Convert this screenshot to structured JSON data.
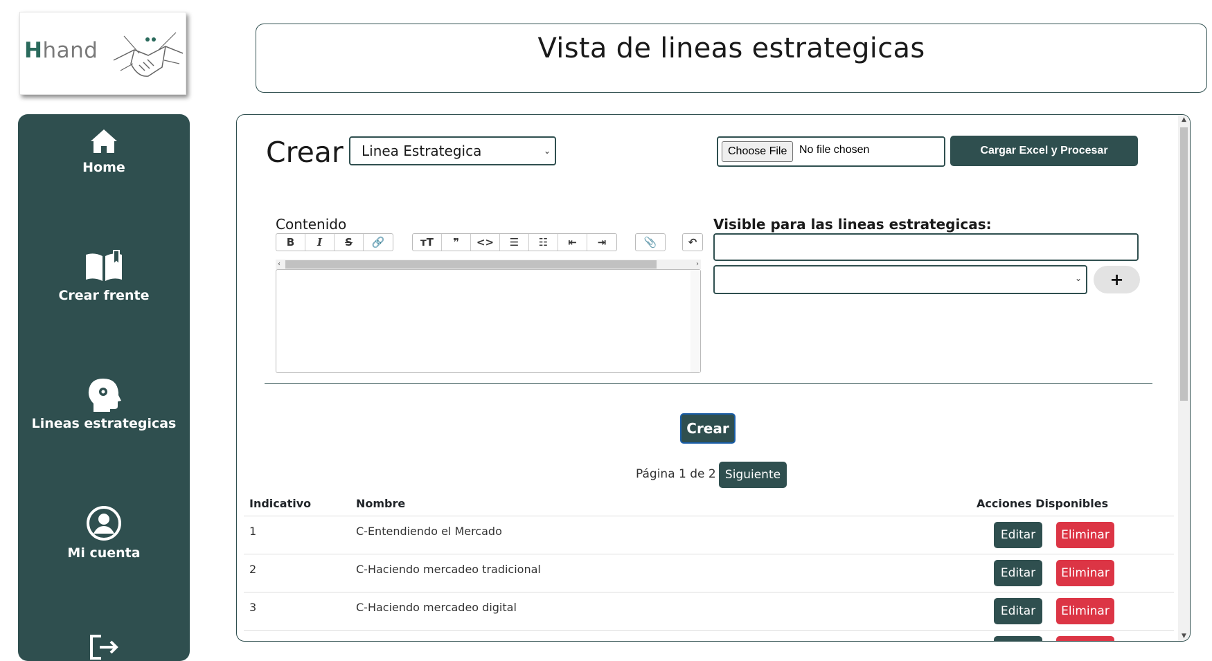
{
  "logo": {
    "text_h": "H",
    "text_rest": "hand",
    "icon": "handshake-icon"
  },
  "sidebar": {
    "items": [
      {
        "label": "Home",
        "icon": "home-icon"
      },
      {
        "label": "Crear frente",
        "icon": "book-icon"
      },
      {
        "label": "Lineas estrategicas",
        "icon": "head-gear-icon"
      },
      {
        "label": "Mi cuenta",
        "icon": "user-circle-icon"
      },
      {
        "label": "",
        "icon": "logout-icon"
      }
    ]
  },
  "header": {
    "title": "Vista de lineas estrategicas"
  },
  "form": {
    "crear_title": "Crear",
    "type_select_value": "Linea Estrategica",
    "file_button": "Choose File",
    "file_status": "No file chosen",
    "cargar_button": "Cargar Excel y Procesar",
    "contenido_label": "Contenido",
    "visible_label": "Visible para las lineas estrategicas:",
    "plus_button": "+",
    "crear_button": "Crear",
    "toolbar": {
      "group1": [
        "B",
        "I",
        "S",
        "🔗"
      ],
      "group2": [
        "тТ",
        "❞",
        "<>",
        "☰",
        "☷",
        "⇤",
        "⇥"
      ],
      "group3": [
        "📎"
      ],
      "group4": [
        "↶"
      ]
    }
  },
  "pager": {
    "text": "Página 1 de 2",
    "next_button": "Siguiente"
  },
  "table": {
    "headers": [
      "Indicativo",
      "Nombre",
      "Acciones Disponibles"
    ],
    "rows": [
      {
        "id": "1",
        "name": "C-Entendiendo el Mercado"
      },
      {
        "id": "2",
        "name": "C-Haciendo mercadeo tradicional"
      },
      {
        "id": "3",
        "name": "C-Haciendo mercadeo digital"
      }
    ],
    "edit_label": "Editar",
    "delete_label": "Eliminar"
  },
  "colors": {
    "primary": "#2f4f4f",
    "danger": "#dc3545",
    "focus": "#1a5ea8"
  }
}
